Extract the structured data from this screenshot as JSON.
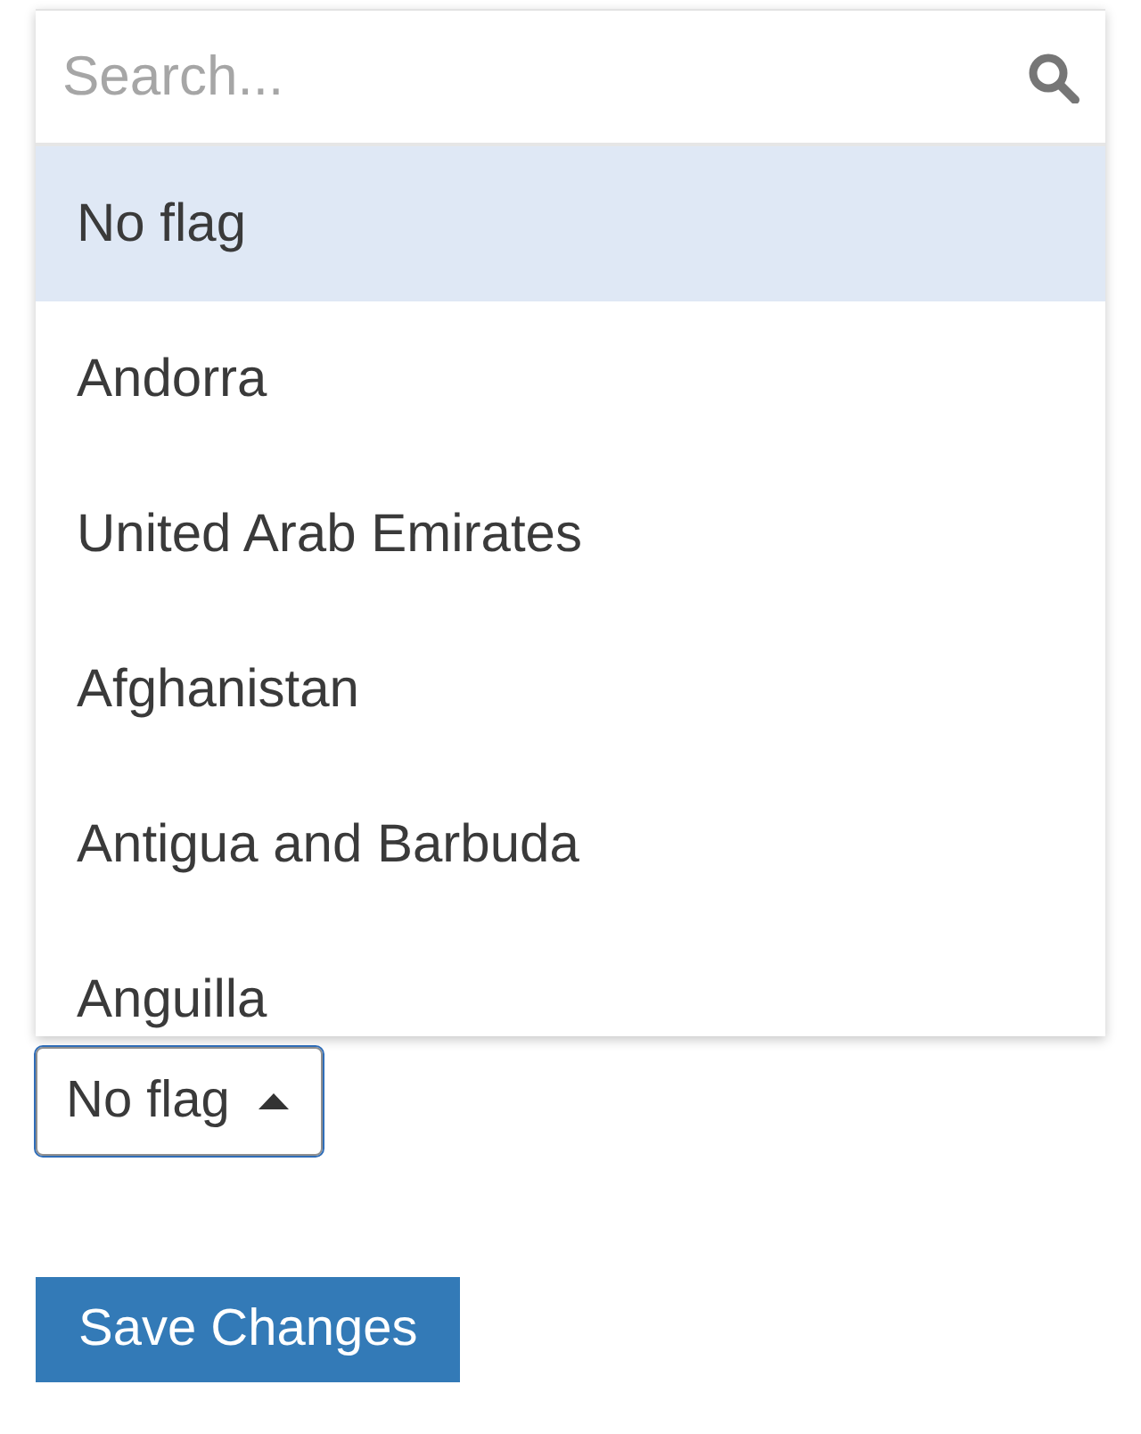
{
  "dropdown": {
    "search": {
      "placeholder": "Search..."
    },
    "options": [
      {
        "label": "No flag",
        "selected": true
      },
      {
        "label": "Andorra",
        "selected": false
      },
      {
        "label": "United Arab Emirates",
        "selected": false
      },
      {
        "label": "Afghanistan",
        "selected": false
      },
      {
        "label": "Antigua and Barbuda",
        "selected": false
      },
      {
        "label": "Anguilla",
        "selected": false
      }
    ]
  },
  "select": {
    "value": "No flag",
    "expanded": true
  },
  "buttons": [
    {
      "label": "Save Changes"
    }
  ]
}
